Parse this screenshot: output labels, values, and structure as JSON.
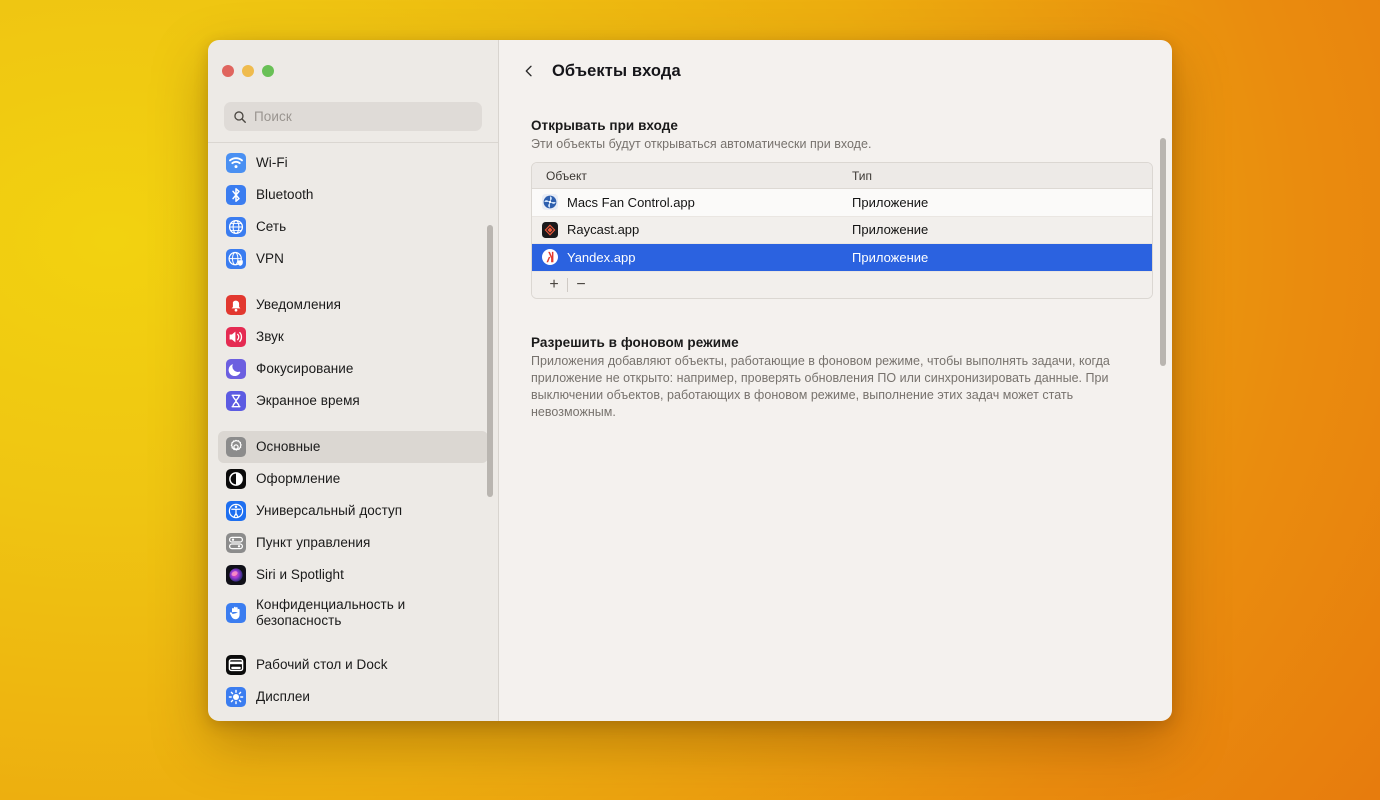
{
  "desktop": {
    "bg_from": "#F2D210",
    "bg_to": "#E5720C"
  },
  "window": {
    "traffic": {
      "close": "close-button",
      "minimize": "minimize-button",
      "zoom": "zoom-button"
    }
  },
  "sidebar": {
    "search": {
      "placeholder": "Поиск",
      "value": "",
      "icon": "search-icon"
    },
    "groups": [
      {
        "items": [
          {
            "label": "Wi-Fi",
            "icon": "wifi-icon",
            "selected": false
          },
          {
            "label": "Bluetooth",
            "icon": "bluetooth-icon",
            "selected": false
          },
          {
            "label": "Сеть",
            "icon": "network-icon",
            "selected": false
          },
          {
            "label": "VPN",
            "icon": "vpn-icon",
            "selected": false
          }
        ]
      },
      {
        "items": [
          {
            "label": "Уведомления",
            "icon": "notifications-icon",
            "selected": false
          },
          {
            "label": "Звук",
            "icon": "sound-icon",
            "selected": false
          },
          {
            "label": "Фокусирование",
            "icon": "focus-icon",
            "selected": false
          },
          {
            "label": "Экранное время",
            "icon": "screen-time-icon",
            "selected": false
          }
        ]
      },
      {
        "items": [
          {
            "label": "Основные",
            "icon": "general-gear-icon",
            "selected": true
          },
          {
            "label": "Оформление",
            "icon": "appearance-icon",
            "selected": false
          },
          {
            "label": "Универсальный доступ",
            "icon": "accessibility-icon",
            "selected": false
          },
          {
            "label": "Пункт управления",
            "icon": "control-center-icon",
            "selected": false
          },
          {
            "label": "Siri и Spotlight",
            "icon": "siri-icon",
            "selected": false
          },
          {
            "label": "Конфиденциальность и\nбезопасность",
            "icon": "privacy-hand-icon",
            "selected": false,
            "two_line": true
          }
        ]
      },
      {
        "items": [
          {
            "label": "Рабочий стол и Dock",
            "icon": "desktop-dock-icon",
            "selected": false
          },
          {
            "label": "Дисплеи",
            "icon": "displays-icon",
            "selected": false
          }
        ]
      }
    ]
  },
  "main": {
    "back_icon": "chevron-left-icon",
    "title": "Объекты входа",
    "section1": {
      "heading": "Открывать при входе",
      "subtitle": "Эти объекты будут открываться автоматически при входе.",
      "columns": [
        "Объект",
        "Тип"
      ],
      "rows": [
        {
          "name": "Macs Fan Control.app",
          "type": "Приложение",
          "icon": "macs-fan-control-icon",
          "selected": false
        },
        {
          "name": "Raycast.app",
          "type": "Приложение",
          "icon": "raycast-icon",
          "selected": false
        },
        {
          "name": "Yandex.app",
          "type": "Приложение",
          "icon": "yandex-icon",
          "selected": true
        }
      ],
      "footer": {
        "add": "+",
        "remove": "−"
      }
    },
    "section2": {
      "heading": "Разрешить в фоновом режиме",
      "body": "Приложения добавляют объекты, работающие в фоновом режиме, чтобы выполнять задачи, когда приложение не открыто: например, проверять обновления ПО или синхронизировать данные. При выключении объектов, работающих в фоновом режиме, выполнение этих задач может стать невозможным."
    },
    "selection_color": "#2B62E0"
  }
}
